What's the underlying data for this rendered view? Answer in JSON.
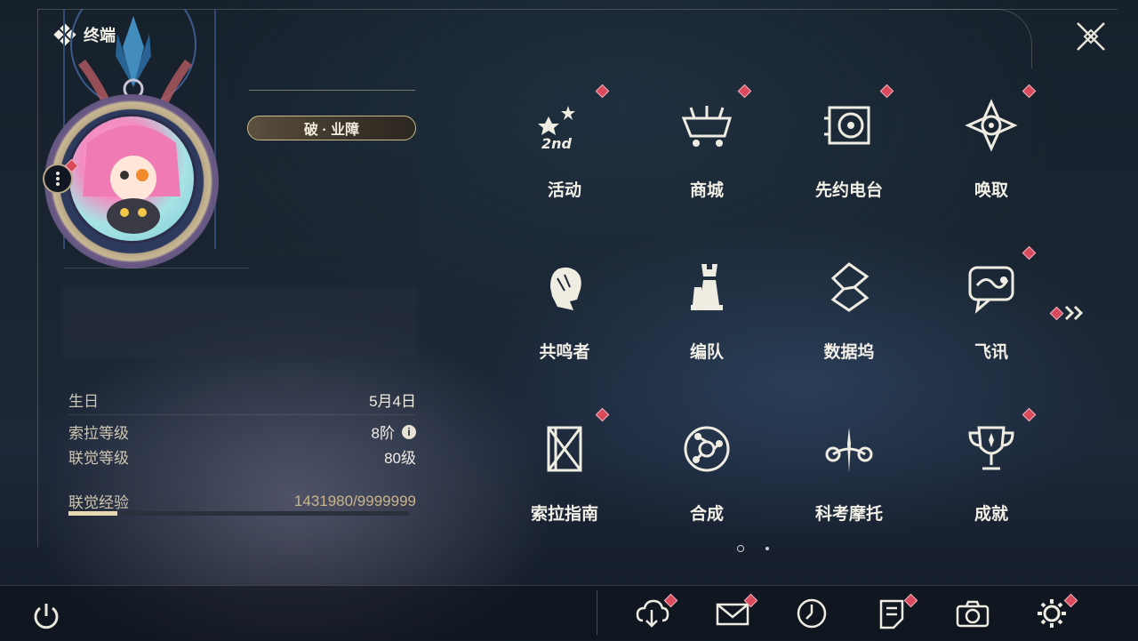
{
  "header": {
    "title": "终端"
  },
  "profile": {
    "title_badge": "破 · 业障",
    "stats": [
      {
        "label": "生日",
        "value": "5月4日"
      },
      {
        "label": "索拉等级",
        "value": "8阶"
      },
      {
        "label": "联觉等级",
        "value": "80级"
      }
    ],
    "experience": {
      "label": "联觉经验",
      "value": "1431980/9999999",
      "progress": 0.143
    }
  },
  "menu": [
    {
      "label": "活动",
      "icon": "event-2nd-hd-icon",
      "badge": true
    },
    {
      "label": "商城",
      "icon": "shop-cart-icon",
      "badge": true
    },
    {
      "label": "先约电台",
      "icon": "radio-icon",
      "badge": true
    },
    {
      "label": "唤取",
      "icon": "convene-icon",
      "badge": true
    },
    {
      "label": "共鸣者",
      "icon": "resonator-icon",
      "badge": false
    },
    {
      "label": "编队",
      "icon": "team-chess-icon",
      "badge": false
    },
    {
      "label": "数据坞",
      "icon": "data-bank-icon",
      "badge": false
    },
    {
      "label": "飞讯",
      "icon": "chat-message-icon",
      "badge": true
    },
    {
      "label": "索拉指南",
      "icon": "guide-book-icon",
      "badge": true
    },
    {
      "label": "合成",
      "icon": "synthesis-icon",
      "badge": false
    },
    {
      "label": "科考摩托",
      "icon": "motorcycle-icon",
      "badge": false
    },
    {
      "label": "成就",
      "icon": "trophy-icon",
      "badge": true
    }
  ],
  "bottom_bar": [
    {
      "icon": "download-cloud-icon",
      "badge": true
    },
    {
      "icon": "mail-icon",
      "badge": true
    },
    {
      "icon": "clock-icon",
      "badge": false
    },
    {
      "icon": "notice-icon",
      "badge": true
    },
    {
      "icon": "camera-icon",
      "badge": false
    },
    {
      "icon": "settings-gear-icon",
      "badge": true
    }
  ],
  "colors": {
    "badge": "#d84a5c",
    "accent_gold": "#cbb58a",
    "text": "#f2efe6"
  }
}
